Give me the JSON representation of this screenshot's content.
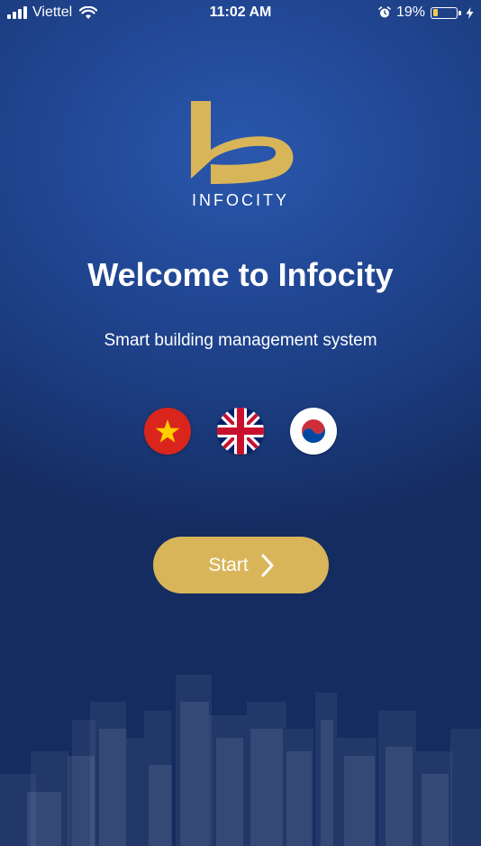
{
  "status_bar": {
    "carrier": "Viettel",
    "time": "11:02 AM",
    "battery_percent": "19%",
    "battery_level": 0.19,
    "icons": [
      "signal-icon",
      "wifi-icon",
      "alarm-icon",
      "battery-icon",
      "charging-icon"
    ]
  },
  "logo": {
    "wordmark": "INFOCITY",
    "color": "#d9b55a"
  },
  "welcome": {
    "title": "Welcome to Infocity",
    "subtitle": "Smart building management system"
  },
  "languages": [
    {
      "code": "vi",
      "icon": "vietnam-flag-icon"
    },
    {
      "code": "en",
      "icon": "uk-flag-icon"
    },
    {
      "code": "ko",
      "icon": "korea-flag-icon"
    }
  ],
  "start_button": {
    "label": "Start",
    "color": "#d9b55a",
    "icon": "chevron-right-icon"
  },
  "colors": {
    "background": "#1d3f85",
    "accent": "#d9b55a"
  }
}
